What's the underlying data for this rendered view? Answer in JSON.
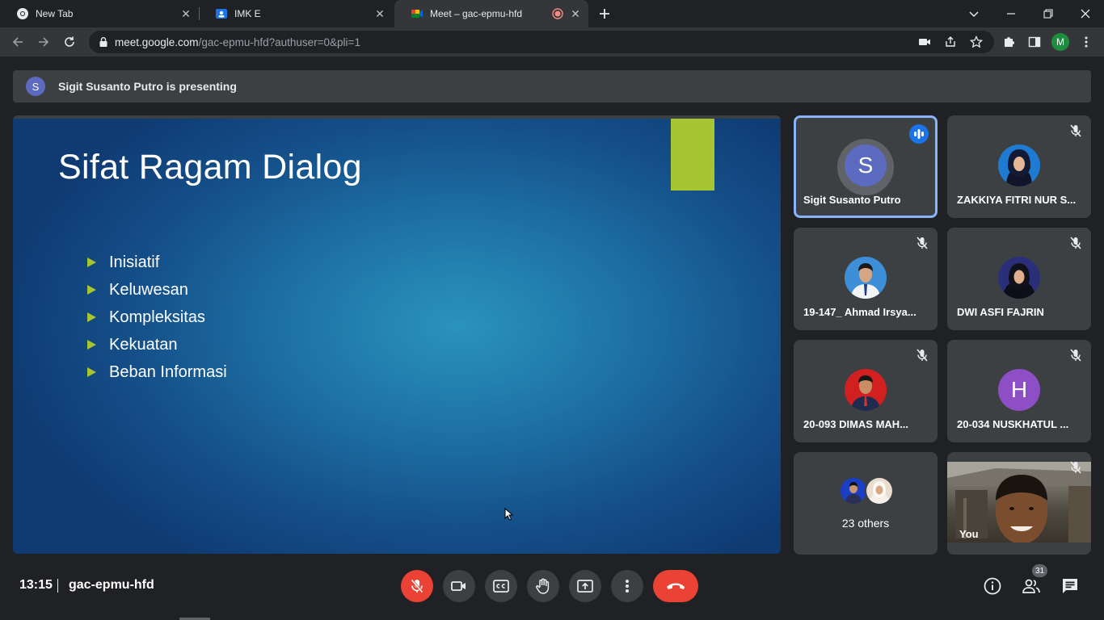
{
  "browser": {
    "tabs": [
      {
        "title": "New Tab",
        "icon": "chrome-icon"
      },
      {
        "title": "IMK E",
        "icon": "classroom-icon"
      },
      {
        "title": "Meet – gac-epmu-hfd",
        "icon": "meet-icon",
        "recording": true
      }
    ],
    "url_host": "meet.google.com",
    "url_path": "/gac-epmu-hfd?authuser=0&pli=1",
    "profile_initial": "M"
  },
  "banner": {
    "avatar_initial": "S",
    "text": "Sigit Susanto Putro is presenting"
  },
  "slide": {
    "title": "Sifat Ragam Dialog",
    "bullets": [
      "Inisiatif",
      "Keluwesan",
      "Kompleksitas",
      "Kekuatan",
      "Beban Informasi"
    ],
    "accent_color": "#a6c531"
  },
  "participants": [
    {
      "name": "Sigit Susanto Putro",
      "initial": "S",
      "avatar_color": "#5c6bc0",
      "speaking": true
    },
    {
      "name": "ZAKKIYA FITRI NUR S...",
      "muted": true
    },
    {
      "name": "19-147_ Ahmad Irsya...",
      "muted": true
    },
    {
      "name": "DWI ASFI FAJRIN",
      "muted": true
    },
    {
      "name": "20-093 DIMAS MAH...",
      "muted": true
    },
    {
      "name": "20-034 NUSKHATUL ...",
      "initial": "H",
      "avatar_color": "#8e4ec6",
      "muted": true
    }
  ],
  "others": {
    "label": "23 others"
  },
  "self": {
    "label": "You"
  },
  "bottom": {
    "time": "13:15",
    "meeting_code": "gac-epmu-hfd",
    "people_count": "31"
  },
  "colors": {
    "background": "#202124",
    "tile": "#3c4043",
    "end_call": "#ea4335",
    "speaking_border": "#8ab4f8"
  }
}
